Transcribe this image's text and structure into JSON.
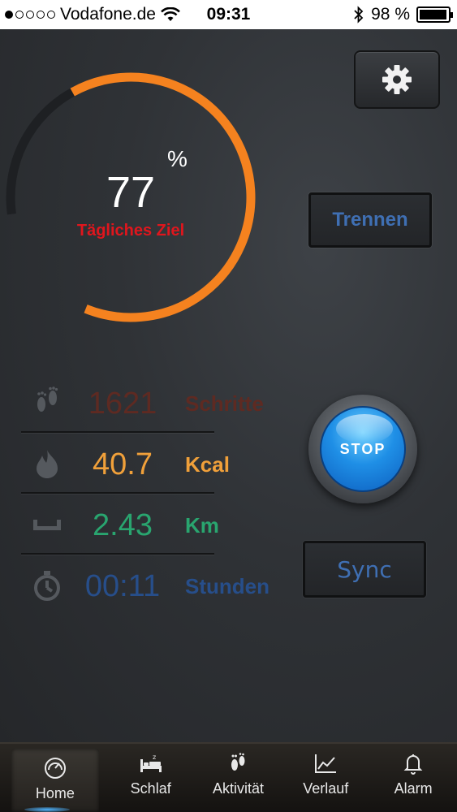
{
  "status_bar": {
    "carrier": "Vodafone.de",
    "time": "09:31",
    "battery_pct": 98,
    "battery_text": "98 %",
    "signal_bars_filled": 1,
    "signal_bars_total": 5
  },
  "goal": {
    "value": "77",
    "percent_sign": "%",
    "label": "Tägliches Ziel",
    "progress_fraction": 0.77,
    "ring_color": "#f5821f",
    "track_color": "#1e2023"
  },
  "buttons": {
    "trennen": "Trennen",
    "sync": "Sync",
    "stop": "STOP",
    "settings_icon": "gear-icon"
  },
  "stats": [
    {
      "icon": "footprints-icon",
      "value": "1621",
      "unit": "Schritte",
      "color": "#5e2a22"
    },
    {
      "icon": "flame-icon",
      "value": "40.7",
      "unit": "Kcal",
      "color": "#f0a03a"
    },
    {
      "icon": "ruler-icon",
      "value": "2.43",
      "unit": "Km",
      "color": "#29a56f"
    },
    {
      "icon": "stopwatch-icon",
      "value": "00:11",
      "unit": "Stunden",
      "color": "#274e8a"
    }
  ],
  "tabs": [
    {
      "label": "Home",
      "icon": "speedometer-icon",
      "active": true
    },
    {
      "label": "Schlaf",
      "icon": "bed-icon",
      "active": false
    },
    {
      "label": "Aktivität",
      "icon": "footprints-icon",
      "active": false
    },
    {
      "label": "Verlauf",
      "icon": "line-chart-icon",
      "active": false
    },
    {
      "label": "Alarm",
      "icon": "bell-icon",
      "active": false
    }
  ]
}
